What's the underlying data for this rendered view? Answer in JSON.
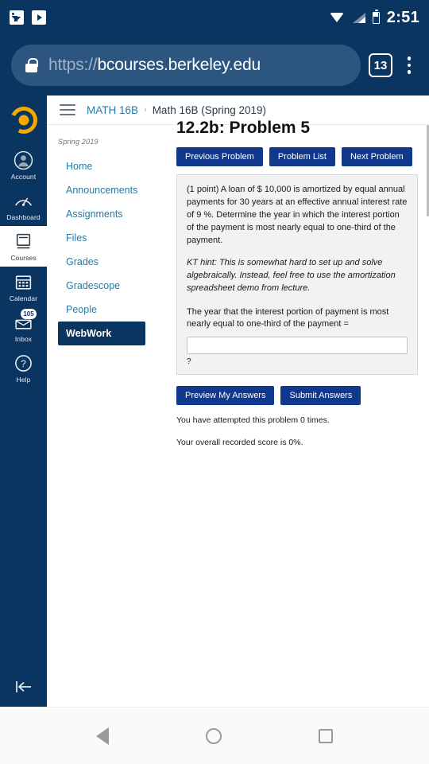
{
  "status_bar": {
    "time": "2:51",
    "icons": [
      "image-notification-icon",
      "video-notification-icon",
      "wifi-icon",
      "cellular-signal-icon",
      "battery-icon"
    ]
  },
  "browser": {
    "url_scheme": "https://",
    "url_host": "bcourses.berkeley.edu",
    "lock_icon": "lock-icon",
    "tab_count": "13",
    "menu_icon": "kebab-menu-icon"
  },
  "global_nav": {
    "logo": "canvas-logo",
    "items": [
      {
        "label": "Account",
        "icon": "account-avatar-icon",
        "active": false
      },
      {
        "label": "Dashboard",
        "icon": "dashboard-speedometer-icon",
        "active": false
      },
      {
        "label": "Courses",
        "icon": "courses-book-icon",
        "active": true
      },
      {
        "label": "Calendar",
        "icon": "calendar-icon",
        "active": false
      },
      {
        "label": "Inbox",
        "icon": "inbox-envelope-icon",
        "active": false,
        "badge": "105"
      },
      {
        "label": "Help",
        "icon": "help-question-icon",
        "active": false
      }
    ],
    "collapse_icon": "collapse-left-arrow-icon"
  },
  "breadcrumb": {
    "menu_icon": "hamburger-menu-icon",
    "course_code": "MATH 16B",
    "separator": "›",
    "course_name": "Math 16B (Spring 2019)"
  },
  "course_nav": {
    "term": "Spring 2019",
    "items": [
      {
        "label": "Home",
        "active": false
      },
      {
        "label": "Announcements",
        "active": false
      },
      {
        "label": "Assignments",
        "active": false
      },
      {
        "label": "Files",
        "active": false
      },
      {
        "label": "Grades",
        "active": false
      },
      {
        "label": "Gradescope",
        "active": false
      },
      {
        "label": "People",
        "active": false
      },
      {
        "label": "WebWork",
        "active": true
      }
    ]
  },
  "webwork": {
    "title": "12.2b: Problem 5",
    "nav_buttons": [
      {
        "label": "Previous Problem"
      },
      {
        "label": "Problem List"
      },
      {
        "label": "Next Problem"
      }
    ],
    "problem_text": "(1 point) A loan of $ 10,000 is amortized by equal annual payments for 30 years at an effective annual interest rate of 9 %. Determine the year in which the interest portion of the payment is most nearly equal to one-third of the payment.",
    "hint_text": "KT hint: This is somewhat hard to set up and solve algebraically. Instead, feel free to use the amortization spreadsheet demo from lecture.",
    "prompt_text": "The year that the interest portion of payment is most nearly equal to one-third of the payment =",
    "answer_value": "",
    "question_mark": "?",
    "submit_buttons": [
      {
        "label": "Preview My Answers"
      },
      {
        "label": "Submit Answers"
      }
    ],
    "attempt_text": "You have attempted this problem 0 times.",
    "attempt_text_clipped": "Your overall recorded score is 0%."
  },
  "android_nav": {
    "back": "back-triangle-icon",
    "home": "home-circle-icon",
    "recents": "recents-square-icon"
  },
  "colors": {
    "chrome_blue": "#0b3561",
    "omnibox_blue": "#2c5580",
    "canvas_gold": "#f2a900",
    "link_teal": "#2b7a9e",
    "webwork_blue": "#10388c"
  }
}
